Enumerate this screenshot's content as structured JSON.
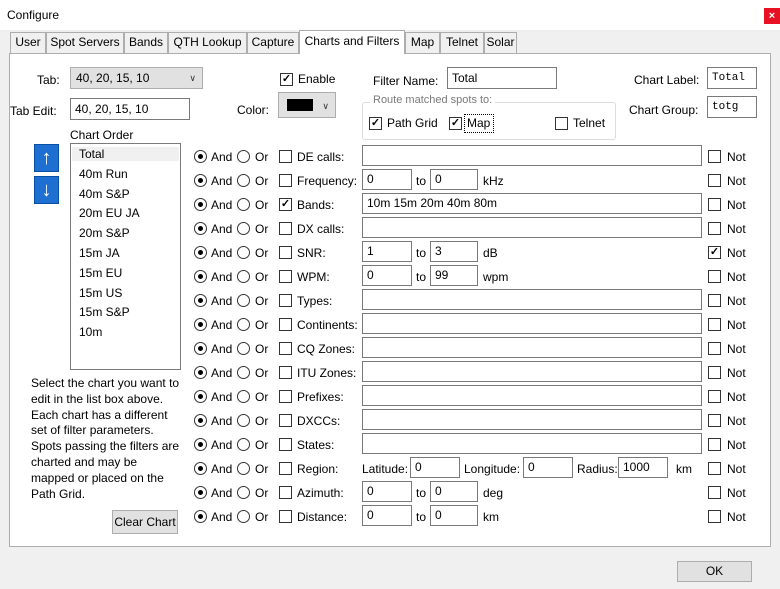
{
  "window": {
    "title": "Configure",
    "close_glyph": "×"
  },
  "tabs": [
    "User",
    "Spot Servers",
    "Bands",
    "QTH Lookup",
    "Capture",
    "Charts and Filters",
    "Map",
    "Telnet",
    "Solar"
  ],
  "active_tab": "Charts and Filters",
  "top": {
    "tab_label": "Tab:",
    "tab_value": "40, 20, 15, 10",
    "tab_edit_label": "Tab Edit:",
    "tab_edit_value": "40, 20, 15, 10",
    "enable_label": "Enable",
    "enable_checked": true,
    "color_label": "Color:",
    "color_value": "#000000",
    "filter_name_label": "Filter Name:",
    "filter_name_value": "Total",
    "route_legend": "Route matched spots to:",
    "route_path_grid": "Path Grid",
    "route_map": "Map",
    "route_telnet": "Telnet",
    "chart_label_label": "Chart Label:",
    "chart_label_value": "Total",
    "chart_group_label": "Chart Group:",
    "chart_group_value": "totg"
  },
  "chart_order": {
    "label": "Chart Order",
    "items": [
      "Total",
      "40m Run",
      "40m S&P",
      "20m EU JA",
      "20m S&P",
      "15m JA",
      "15m EU",
      "15m US",
      "15m S&P",
      "10m"
    ],
    "selected": 0
  },
  "help_text": "Select the chart you want to edit in the list box above. Each chart has a different set of filter parameters. Spots passing the filters are charted and may be mapped or placed on the Path Grid.",
  "clear_chart_label": "Clear Chart",
  "and_label": "And",
  "or_label": "Or",
  "not_label": "Not",
  "to_label": "to",
  "filters": [
    {
      "label": "DE calls:",
      "checked": false,
      "value": "",
      "not": false
    },
    {
      "label": "Frequency:",
      "checked": false,
      "from": "0",
      "to": "0",
      "unit": "kHz",
      "not": false
    },
    {
      "label": "Bands:",
      "checked": true,
      "value": "10m 15m 20m 40m 80m",
      "not": false
    },
    {
      "label": "DX calls:",
      "checked": false,
      "value": "",
      "not": false
    },
    {
      "label": "SNR:",
      "checked": false,
      "from": "1",
      "to": "3",
      "unit": "dB",
      "not": true
    },
    {
      "label": "WPM:",
      "checked": false,
      "from": "0",
      "to": "99",
      "unit": "wpm",
      "not": false
    },
    {
      "label": "Types:",
      "checked": false,
      "value": "",
      "not": false
    },
    {
      "label": "Continents:",
      "checked": false,
      "value": "",
      "not": false
    },
    {
      "label": "CQ Zones:",
      "checked": false,
      "value": "",
      "not": false
    },
    {
      "label": "ITU Zones:",
      "checked": false,
      "value": "",
      "not": false
    },
    {
      "label": "Prefixes:",
      "checked": false,
      "value": "",
      "not": false
    },
    {
      "label": "DXCCs:",
      "checked": false,
      "value": "",
      "not": false
    },
    {
      "label": "States:",
      "checked": false,
      "value": "",
      "not": false
    },
    {
      "label": "Region:",
      "checked": false,
      "latitude_label": "Latitude:",
      "latitude": "0",
      "longitude_label": "Longitude:",
      "longitude": "0",
      "radius_label": "Radius:",
      "radius": "1000",
      "unit": "km",
      "not": false
    },
    {
      "label": "Azimuth:",
      "checked": false,
      "from": "0",
      "to": "0",
      "unit": "deg",
      "not": false
    },
    {
      "label": "Distance:",
      "checked": false,
      "from": "0",
      "to": "0",
      "unit": "km",
      "not": false
    }
  ],
  "ok_label": "OK"
}
